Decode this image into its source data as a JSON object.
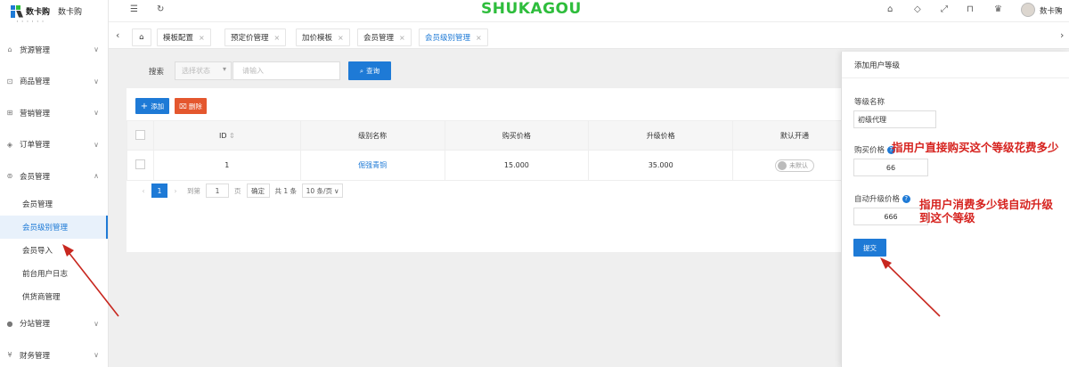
{
  "brand": {
    "logo_text": "数卡购",
    "app_name": "数卡购",
    "banner": "SHUKAGOU"
  },
  "sidebar": {
    "items": [
      {
        "label": "货源管理",
        "icon": "store-icon",
        "expanded": false
      },
      {
        "label": "商品管理",
        "icon": "cart-icon",
        "expanded": false
      },
      {
        "label": "营销管理",
        "icon": "gift-icon",
        "expanded": false
      },
      {
        "label": "订单管理",
        "icon": "order-icon",
        "expanded": false
      },
      {
        "label": "会员管理",
        "icon": "user-icon",
        "expanded": true
      },
      {
        "label": "分站管理",
        "icon": "group-icon",
        "expanded": false
      },
      {
        "label": "财务管理",
        "icon": "finance-icon",
        "expanded": false
      }
    ],
    "member_submenu": [
      "会员管理",
      "会员级别管理",
      "会员导入",
      "前台用户日志",
      "供货商管理"
    ],
    "active_sub": "会员级别管理"
  },
  "topbar": {
    "username": "数卡购"
  },
  "tabs": [
    {
      "label": "模板配置"
    },
    {
      "label": "预定价管理"
    },
    {
      "label": "加价模板"
    },
    {
      "label": "会员管理"
    },
    {
      "label": "会员级别管理"
    }
  ],
  "search": {
    "label": "搜索",
    "select_placeholder": "选择状态",
    "input_placeholder": "请输入",
    "query_button": "查询"
  },
  "toolbar": {
    "add_label": "添加",
    "delete_label": "删除"
  },
  "table": {
    "headers": [
      "ID",
      "级别名称",
      "购买价格",
      "升级价格",
      "默认开通"
    ],
    "rows": [
      {
        "id": "1",
        "name": "倔强青铜",
        "buy_price": "15.000",
        "upgrade_price": "35.000",
        "default": "未默认"
      }
    ]
  },
  "pagination": {
    "current_page": "1",
    "goto_label": "到第",
    "goto_value": "1",
    "page_unit": "页",
    "confirm": "确定",
    "total": "共 1 条",
    "page_size": "10 条/页"
  },
  "drawer": {
    "title": "添加用户等级",
    "name_label": "等级名称",
    "name_value": "初级代理",
    "buy_label": "购买价格",
    "buy_value": "66",
    "upgrade_label": "自动升级价格",
    "upgrade_value": "666",
    "submit": "提交"
  },
  "annotations": {
    "buy_note": "指用户直接购买这个等级花费多少",
    "upgrade_note_line1": "指用户消费多少钱自动升级",
    "upgrade_note_line2": "到这个等级"
  },
  "colors": {
    "primary": "#1e7ad6",
    "danger": "#e4572e",
    "brand_green": "#2ebd3c",
    "note_red": "#d6231f"
  }
}
